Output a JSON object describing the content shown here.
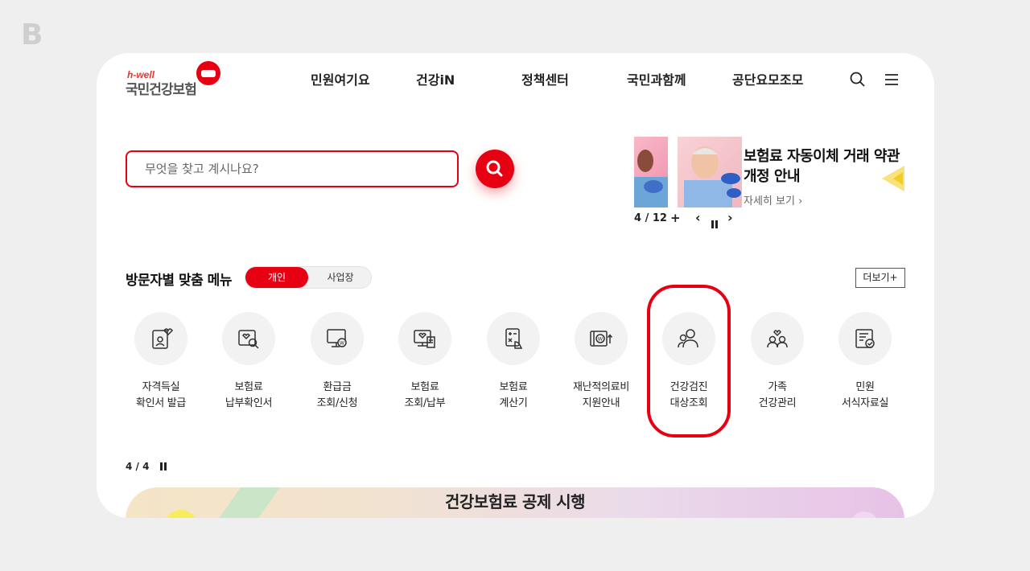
{
  "header": {
    "logo_sub": "h-well",
    "logo_main": "국민건강보험",
    "nav": [
      "민원여기요",
      "건강iN",
      "정책센터",
      "국민과함께",
      "공단요모조모"
    ]
  },
  "search": {
    "placeholder": "무엇을 찾고 계시나요?"
  },
  "banner": {
    "title": "보험료 자동이체 거래 약관 개정 안내",
    "more": "자세히 보기 ›",
    "counter": "4 / 12",
    "plus": "+",
    "prev": "‹",
    "next": "›"
  },
  "menu_section": {
    "title": "방문자별 맞춤 메뉴",
    "tab_on": "개인",
    "tab_off": "사업장",
    "more": "더보기+",
    "items": [
      {
        "label": "자격득실\n확인서 발급",
        "icon": "id-card-icon"
      },
      {
        "label": "보험료\n납부확인서",
        "icon": "document-search-icon"
      },
      {
        "label": "환급금\n조회/신청",
        "icon": "monitor-won-icon"
      },
      {
        "label": "보험료\n조회/납부",
        "icon": "payment-receipt-icon"
      },
      {
        "label": "보험료\n계산기",
        "icon": "calculator-icon"
      },
      {
        "label": "재난적의료비\n지원안내",
        "icon": "medical-support-icon"
      },
      {
        "label": "건강검진\n대상조회",
        "icon": "people-check-icon"
      },
      {
        "label": "가족\n건강관리",
        "icon": "family-heart-icon"
      },
      {
        "label": "민원\n서식자료실",
        "icon": "form-check-icon"
      }
    ],
    "pager": "4 / 4"
  },
  "bottom_banner": {
    "title": "건강보험료 공제 시행"
  },
  "colors": {
    "accent": "#e60012"
  }
}
